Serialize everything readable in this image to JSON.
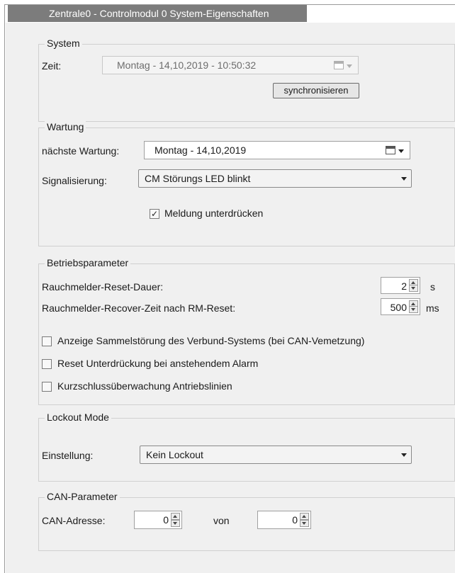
{
  "window": {
    "tab_title": "Zentrale0 - Controlmodul 0 System-Eigenschaften"
  },
  "system": {
    "title": "System",
    "zeit_label": "Zeit:",
    "zeit_value": "Montag   - 14,10,2019 - 10:50:32",
    "sync_button": "synchronisieren"
  },
  "wartung": {
    "title": "Wartung",
    "next_label": "nächste Wartung:",
    "next_value": "Montag   - 14,10,2019",
    "signal_label": "Signalisierung:",
    "signal_value": "CM Störungs LED blinkt",
    "suppress_label": "Meldung unterdrücken",
    "suppress_checked": true
  },
  "betrieb": {
    "title": "Betriebsparameter",
    "reset_label": "Rauchmelder-Reset-Dauer:",
    "reset_value": "2",
    "reset_unit": "s",
    "recover_label": "Rauchmelder-Recover-Zeit nach RM-Reset:",
    "recover_value": "500",
    "recover_unit": "ms",
    "opt1": "Anzeige Sammelstörung des Verbund-Systems (bei CAN-Vemetzung)",
    "opt2": "Reset Unterdrückung bei anstehendem Alarm",
    "opt3": "Kurzschlussüberwachung Antriebslinien"
  },
  "lockout": {
    "title": "Lockout Mode",
    "setting_label": "Einstellung:",
    "setting_value": "Kein Lockout"
  },
  "can": {
    "title": "CAN-Parameter",
    "addr_label": "CAN-Adresse:",
    "addr_value": "0",
    "von_label": "von",
    "von_value": "0"
  }
}
